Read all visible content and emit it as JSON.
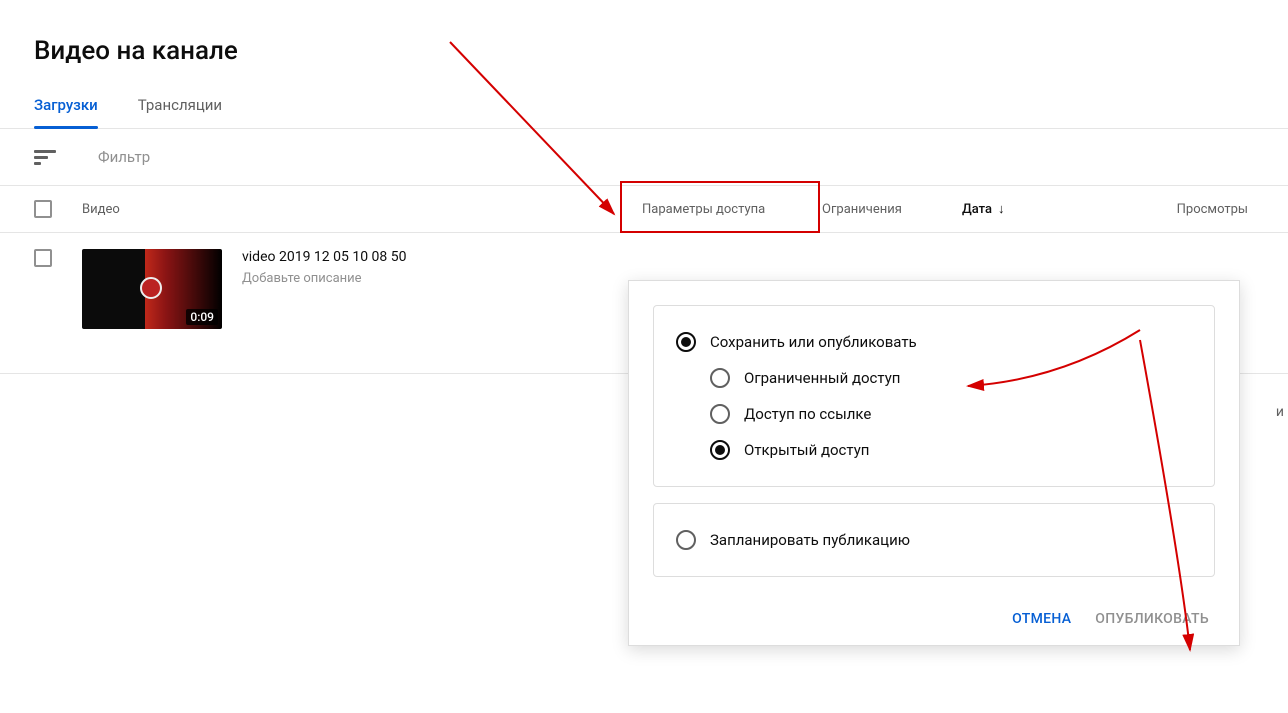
{
  "page_title": "Видео на канале",
  "tabs": [
    {
      "label": "Загрузки",
      "active": true
    },
    {
      "label": "Трансляции",
      "active": false
    }
  ],
  "filter_placeholder": "Фильтр",
  "columns": {
    "video": "Видео",
    "visibility": "Параметры доступа",
    "restrictions": "Ограничения",
    "date": "Дата",
    "views": "Просмотры"
  },
  "video": {
    "title": "video 2019 12 05 10 08 50",
    "description_placeholder": "Добавьте описание",
    "duration": "0:09"
  },
  "popup": {
    "save_or_publish": "Сохранить или опубликовать",
    "private": "Ограниченный доступ",
    "unlisted": "Доступ по ссылке",
    "public": "Открытый доступ",
    "schedule": "Запланировать публикацию",
    "cancel": "ОТМЕНА",
    "publish": "ОПУБЛИКОВАТЬ"
  },
  "truncated_edge_char": "и",
  "colors": {
    "accent": "#065fd4",
    "annotation": "#d40000"
  }
}
